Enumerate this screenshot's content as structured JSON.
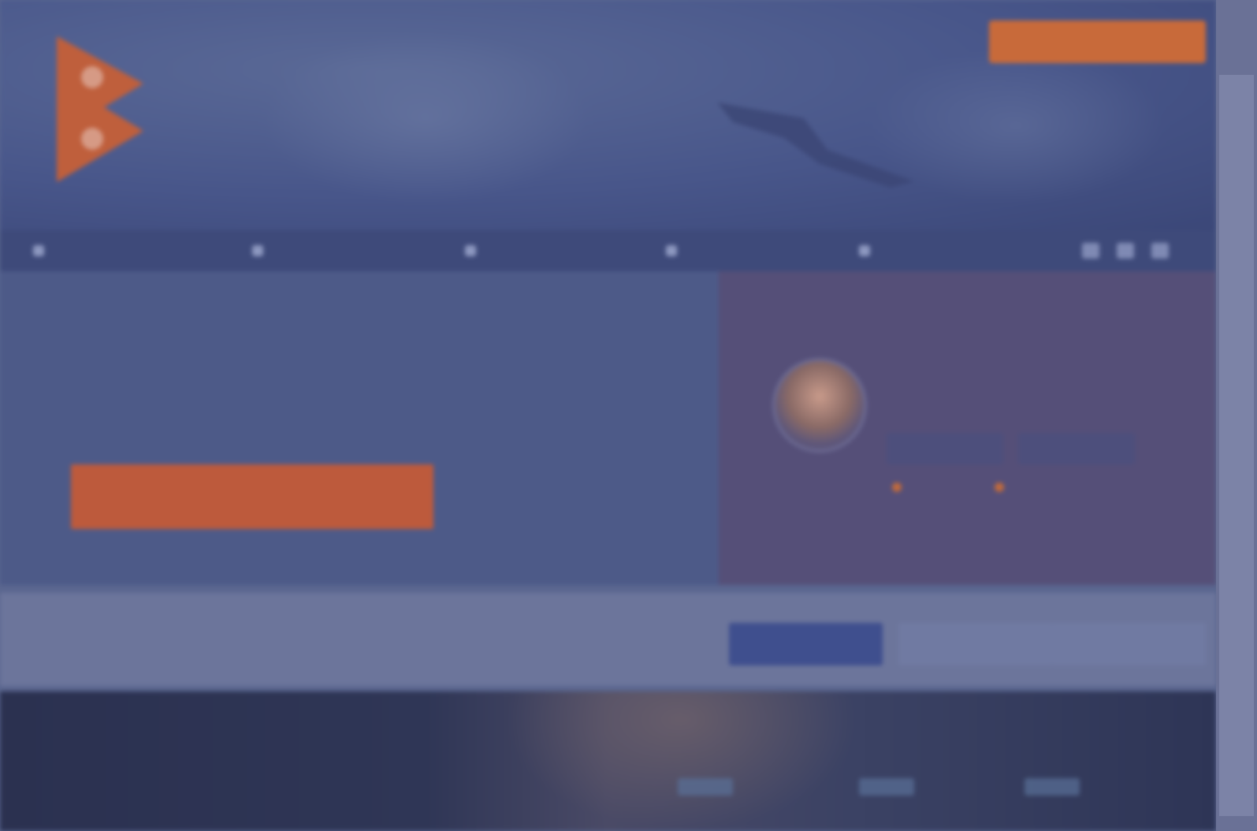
{
  "header": {
    "cta_label": "",
    "logo_alt": ""
  },
  "nav": {
    "items": [
      {
        "label": "",
        "icon": "user-icon"
      },
      {
        "label": "",
        "icon": "trophy-icon"
      },
      {
        "label": "",
        "icon": "bag-icon"
      },
      {
        "label": "",
        "icon": "star-icon"
      },
      {
        "label": "",
        "icon": "chat-icon"
      }
    ],
    "social": [
      "facebook-icon",
      "twitter-icon",
      "instagram-icon"
    ]
  },
  "intro": {
    "headline_line1": "",
    "headline_line2": "",
    "start_button": ""
  },
  "sidebar": {
    "title": "",
    "profile_name": "",
    "profile_desc": "",
    "pill1": "",
    "pill2": "",
    "stat1": "",
    "stat2": ""
  },
  "subcategory": {
    "title": "",
    "tabs": [
      "",
      "",
      ""
    ]
  },
  "colors": {
    "overlay": "#4b5886",
    "accent": "#c86a3a",
    "nav_bg": "#3e4a7a"
  }
}
